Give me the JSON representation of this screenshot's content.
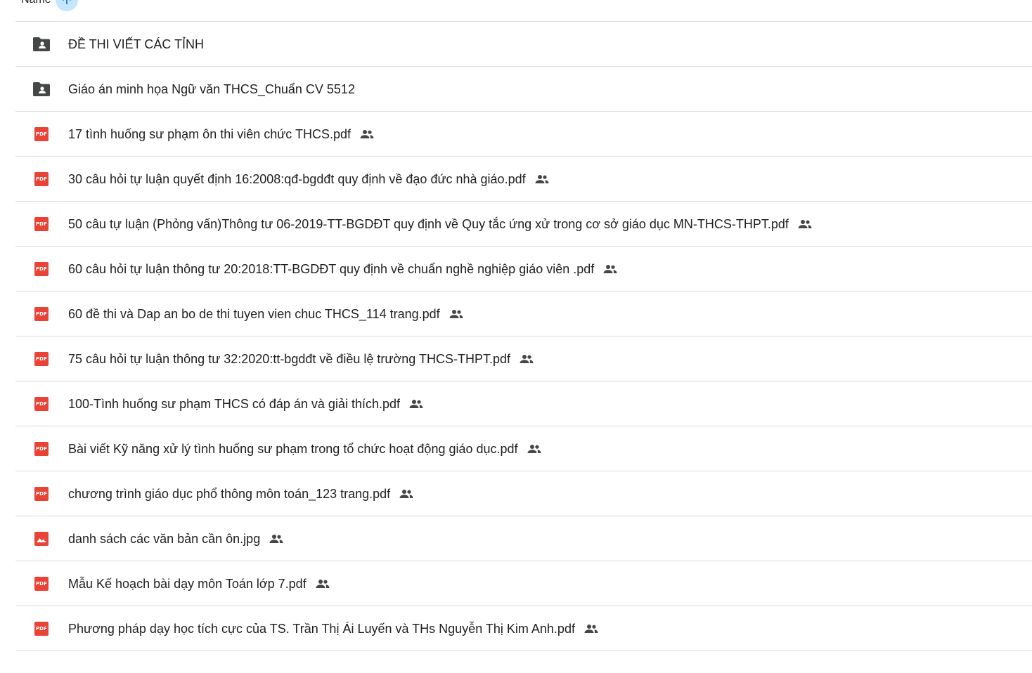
{
  "header": {
    "column_label": "Name"
  },
  "colors": {
    "pdf": "#ea4335",
    "folder": "#444746",
    "divider": "#dadce0",
    "sort_button": "#c2e7ff",
    "accent": "#0b57d0"
  },
  "pdf_badge_text": "PDF",
  "files": [
    {
      "name": "ĐỀ THI VIẾT CÁC TỈNH",
      "type": "shared-folder",
      "shared": false
    },
    {
      "name": "Giáo án minh họa Ngữ văn THCS_Chuẩn CV 5512",
      "type": "shared-folder",
      "shared": false
    },
    {
      "name": "17 tình huống sư phạm ôn thi viên chức THCS.pdf",
      "type": "pdf",
      "shared": true
    },
    {
      "name": "30 câu hỏi tự luận quyết định 16:2008:qđ-bgdđt quy định về đạo đức nhà giáo.pdf",
      "type": "pdf",
      "shared": true
    },
    {
      "name": "50 câu tự luận (Phỏng vấn)Thông tư 06-2019-TT-BGDĐT quy định về Quy tắc ứng xử trong cơ sở giáo dục MN-THCS-THPT.pdf",
      "type": "pdf",
      "shared": true
    },
    {
      "name": "60 câu hỏi tự luận thông tư 20:2018:TT-BGDĐT quy định về chuẩn nghề nghiệp giáo viên .pdf",
      "type": "pdf",
      "shared": true
    },
    {
      "name": "60 đề thi và Dap an bo de thi tuyen vien chuc THCS_114 trang.pdf",
      "type": "pdf",
      "shared": true
    },
    {
      "name": "75 câu hỏi tự luận thông tư 32:2020:tt-bgdđt về điều lệ trường THCS-THPT.pdf",
      "type": "pdf",
      "shared": true
    },
    {
      "name": "100-Tình huống sư phạm THCS có đáp án và giải thích.pdf",
      "type": "pdf",
      "shared": true
    },
    {
      "name": "Bài viết Kỹ năng xử lý tình huống sư phạm trong tổ chức hoạt động giáo dục.pdf",
      "type": "pdf",
      "shared": true
    },
    {
      "name": "chương trình giáo dục phổ thông môn toán_123 trang.pdf",
      "type": "pdf",
      "shared": true
    },
    {
      "name": "danh sách các văn bản cần ôn.jpg",
      "type": "image",
      "shared": true
    },
    {
      "name": "Mẫu Kế hoạch bài dạy môn Toán lớp 7.pdf",
      "type": "pdf",
      "shared": true
    },
    {
      "name": "Phương pháp dạy học tích cực của TS. Trần Thị Ái Luyến và THs Nguyễn Thị Kim Anh.pdf",
      "type": "pdf",
      "shared": true
    }
  ]
}
